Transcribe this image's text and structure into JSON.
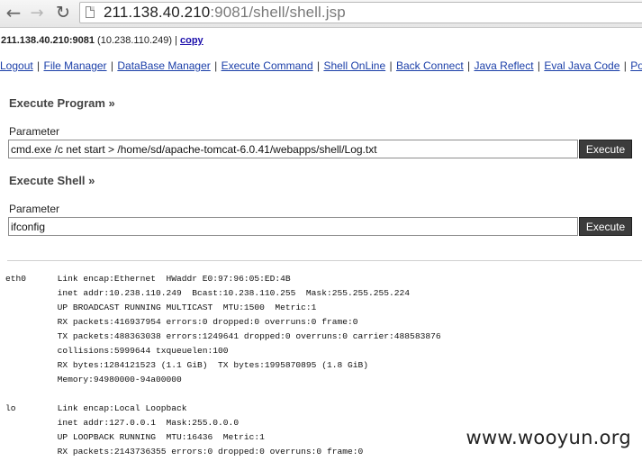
{
  "browser": {
    "url_host": "211.138.40.210",
    "url_rest": ":9081/shell/shell.jsp"
  },
  "header": {
    "host": "211.138.40.210:9081",
    "internal": " (10.238.110.249) | ",
    "copy_label": "copy"
  },
  "menu": {
    "items": [
      "Logout",
      "File Manager",
      "DataBase Manager",
      "Execute Command",
      "Shell OnLine",
      "Back Connect",
      "Java Reflect",
      "Eval Java Code",
      "Port"
    ],
    "separator": "|"
  },
  "execute_program": {
    "title": "Execute Program »",
    "param_label": "Parameter",
    "value": "cmd.exe /c net start > /home/sd/apache-tomcat-6.0.41/webapps/shell/Log.txt",
    "button": "Execute"
  },
  "execute_shell": {
    "title": "Execute Shell »",
    "param_label": "Parameter",
    "value": "ifconfig",
    "button": "Execute"
  },
  "output": {
    "lines": [
      "eth0      Link encap:Ethernet  HWaddr E0:97:96:05:ED:4B",
      "          inet addr:10.238.110.249  Bcast:10.238.110.255  Mask:255.255.255.224",
      "          UP BROADCAST RUNNING MULTICAST  MTU:1500  Metric:1",
      "          RX packets:416937954 errors:0 dropped:0 overruns:0 frame:0",
      "          TX packets:488363038 errors:1249641 dropped:0 overruns:0 carrier:488583876",
      "          collisions:5999644 txqueuelen:100",
      "          RX bytes:1284121523 (1.1 GiB)  TX bytes:1995870895 (1.8 GiB)",
      "          Memory:94980000-94a00000",
      "",
      "lo        Link encap:Local Loopback",
      "          inet addr:127.0.0.1  Mask:255.0.0.0",
      "          UP LOOPBACK RUNNING  MTU:16436  Metric:1",
      "          RX packets:2143736355 errors:0 dropped:0 overruns:0 frame:0"
    ]
  },
  "watermark": "www.wooyun.org",
  "icons": {
    "back": "arrow-left-icon",
    "forward": "arrow-right-icon",
    "reload": "reload-icon",
    "page": "page-icon"
  },
  "colors": {
    "link": "#1a3ea8",
    "button_bg": "#3c3c3c",
    "section_title": "#444444"
  }
}
